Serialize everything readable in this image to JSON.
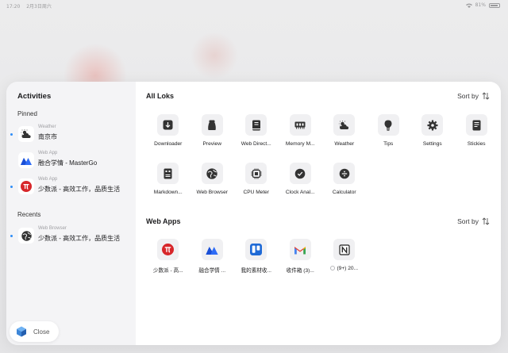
{
  "status_bar": {
    "time": "17:20",
    "date": "2月3日周六",
    "battery": "81%"
  },
  "sidebar": {
    "title": "Activities",
    "pinned_label": "Pinned",
    "recents_label": "Recents",
    "pinned": [
      {
        "kind": "Weather",
        "name": "南京市",
        "icon": "weather-icon"
      },
      {
        "kind": "Web App",
        "name": "融合学情 - MasterGo",
        "icon": "mastergo-icon"
      },
      {
        "kind": "Web App",
        "name": "少数派 - 高效工作，品质生活",
        "icon": "sspai-icon"
      }
    ],
    "recents": [
      {
        "kind": "Web Browser",
        "name": "少数派 - 高效工作，品质生活",
        "icon": "browser-icon"
      }
    ],
    "close_label": "Close"
  },
  "all_loks": {
    "title": "All Loks",
    "sort_label": "Sort by",
    "items": [
      {
        "label": "Downloader",
        "icon": "download-icon"
      },
      {
        "label": "Preview",
        "icon": "preview-icon"
      },
      {
        "label": "Web Direct...",
        "icon": "book-icon"
      },
      {
        "label": "Memory M...",
        "icon": "memory-icon"
      },
      {
        "label": "Weather",
        "icon": "weather-icon"
      },
      {
        "label": "Tips",
        "icon": "bulb-icon"
      },
      {
        "label": "Settings",
        "icon": "gear-icon"
      },
      {
        "label": "Stickies",
        "icon": "note-icon"
      },
      {
        "label": "Markdown...",
        "icon": "markdown-icon"
      },
      {
        "label": "Web Browser",
        "icon": "browser-icon"
      },
      {
        "label": "CPU Meter",
        "icon": "cpu-icon"
      },
      {
        "label": "Clock Anal...",
        "icon": "clock-icon"
      },
      {
        "label": "Calculator",
        "icon": "calculator-icon"
      }
    ]
  },
  "web_apps": {
    "title": "Web Apps",
    "sort_label": "Sort by",
    "items": [
      {
        "label": "少数派 - 高...",
        "icon": "sspai-icon"
      },
      {
        "label": "融合学情 ...",
        "icon": "mastergo-icon"
      },
      {
        "label": "我的素材收...",
        "icon": "trello-icon"
      },
      {
        "label": "收件箱 (3)...",
        "icon": "gmail-icon"
      },
      {
        "label": "(9+) 20...",
        "icon": "notion-icon"
      }
    ]
  },
  "colors": {
    "accent": "#2f8ef7",
    "sspai_red": "#d7262a",
    "mastergo_blue": "#2f6cf6",
    "trello_blue": "#1f6ad6"
  }
}
